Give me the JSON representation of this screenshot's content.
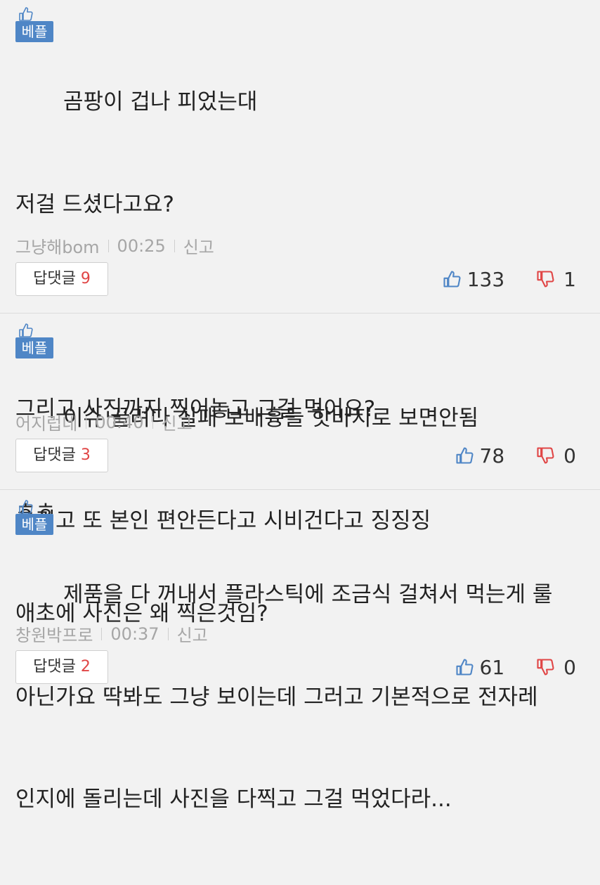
{
  "badge_label": "베플",
  "report_label": "신고",
  "reply_label": "답댓글",
  "colors": {
    "badge": "#4f86c6",
    "like": "#4f86c6",
    "dislike": "#e04545",
    "reply_count": "#e04545"
  },
  "comments": [
    {
      "lines": [
        "곰팡이 겁나 피었는대",
        "저걸 드셨다고요?",
        "",
        "그리고 사진까지 찍어놓고 그걸 먹어요?",
        "ㅎㅎ",
        "애초에 사진은 왜 찍은것임?"
      ],
      "author": "그냥해bom",
      "time": "00:25",
      "reply_count": "9",
      "likes": "133",
      "dislikes": "1"
    },
    {
      "lines": [
        "이슈 끌려다 실패 보배흉들 핫바지로 보면안됨",
        "그리고 또 본인 편안든다고 시비건다고 징징징"
      ],
      "author": "어지럽네",
      "time": "00:40",
      "reply_count": "3",
      "likes": "78",
      "dislikes": "0"
    },
    {
      "lines": [
        "제품을 다 꺼내서 플라스틱에 조금식 걸쳐서 먹는게 룰",
        "아닌가요 딱봐도 그냥 보이는데 그러고 기본적으로 전자레",
        "인지에 돌리는데 사진을 다찍고 그걸 먹었다라..."
      ],
      "author": "창원박프로",
      "time": "00:37",
      "reply_count": "2",
      "likes": "61",
      "dislikes": "0"
    }
  ]
}
